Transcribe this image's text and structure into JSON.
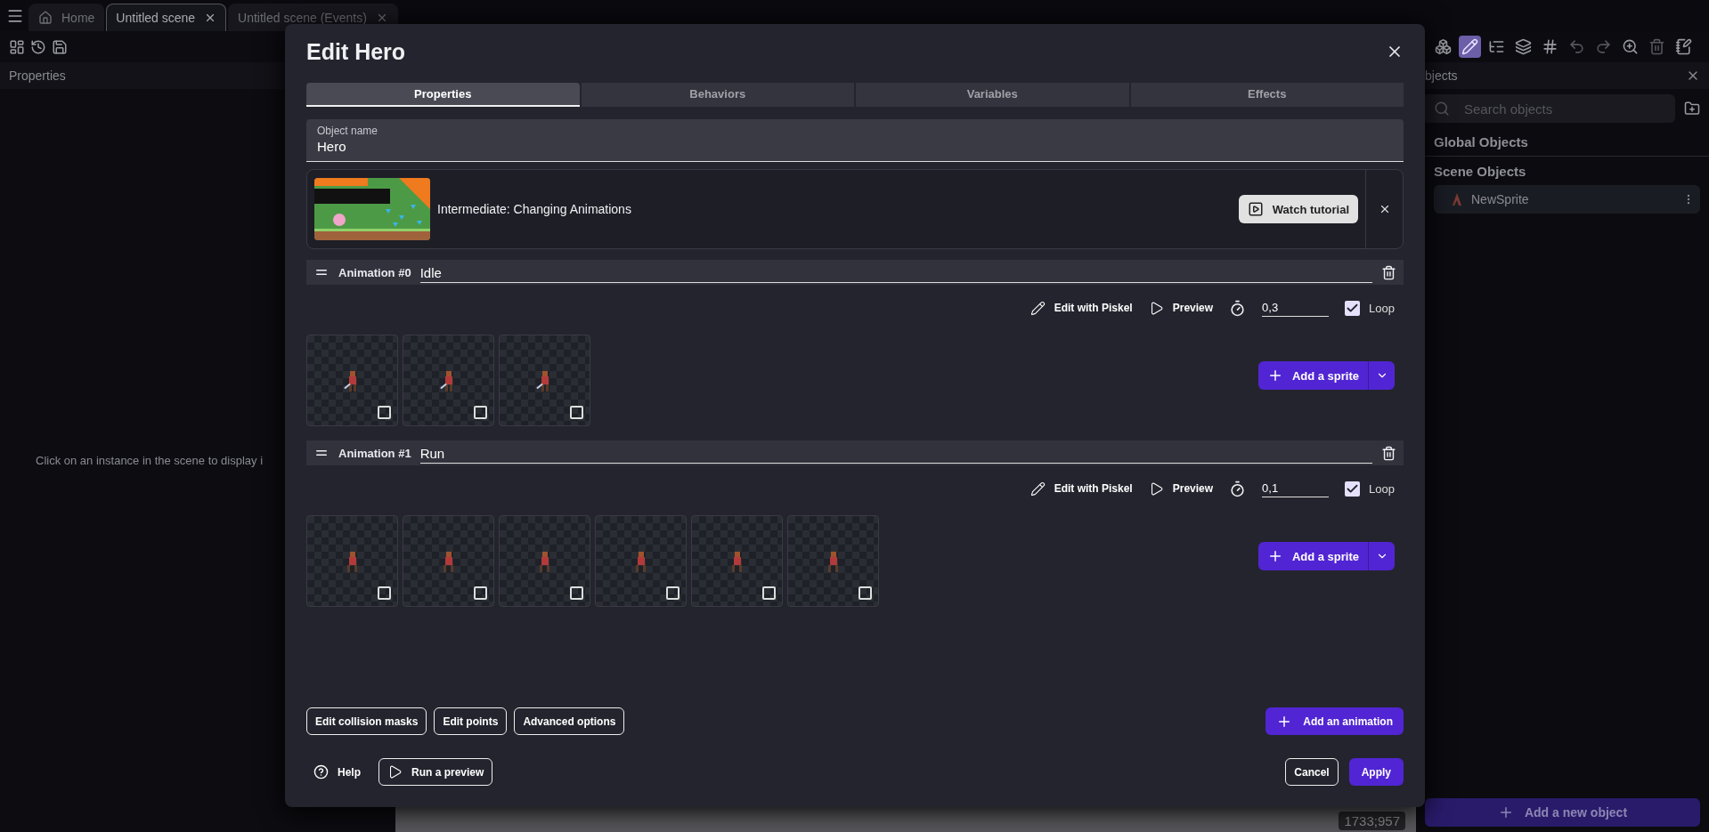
{
  "tabs": [
    {
      "label": "Home",
      "kind": "home",
      "selected": false
    },
    {
      "label": "Untitled scene",
      "kind": "scene",
      "selected": true
    },
    {
      "label": "Untitled scene (Events)",
      "kind": "scene",
      "selected": false
    }
  ],
  "left_panel": {
    "title": "Properties",
    "hint": "Click on an instance in the scene to display i"
  },
  "canvas": {
    "coordinates": "1733;957"
  },
  "tools": [
    {
      "kind": "cubes",
      "selected": false,
      "disabled": false
    },
    {
      "kind": "pencil",
      "selected": true,
      "disabled": false
    },
    {
      "kind": "list",
      "selected": false,
      "disabled": false
    },
    {
      "kind": "layers",
      "selected": false,
      "disabled": false
    },
    {
      "kind": "grid",
      "selected": false,
      "disabled": false
    },
    {
      "kind": "undo",
      "selected": false,
      "disabled": true
    },
    {
      "kind": "redo",
      "selected": false,
      "disabled": true
    },
    {
      "kind": "zoom",
      "selected": false,
      "disabled": false
    },
    {
      "kind": "trash",
      "selected": false,
      "disabled": true
    },
    {
      "kind": "notes",
      "selected": false,
      "disabled": false
    }
  ],
  "right_panel": {
    "title": "bjects",
    "search": {
      "placeholder": "Search objects"
    },
    "groups": [
      "Global Objects",
      "Scene Objects"
    ],
    "objects": [
      {
        "name": "NewSprite",
        "selected": true
      }
    ],
    "add_button": "Add a new object"
  },
  "dialog": {
    "title": "Edit Hero",
    "tabs": [
      {
        "label": "Properties",
        "selected": true
      },
      {
        "label": "Behaviors",
        "selected": false
      },
      {
        "label": "Variables",
        "selected": false
      },
      {
        "label": "Effects",
        "selected": false
      }
    ],
    "object_name": {
      "label": "Object name",
      "value": "Hero"
    },
    "tutorial": {
      "kind": "picture",
      "title": "Intermediate: Changing Animations",
      "button": "Watch tutorial"
    },
    "animations": [
      {
        "label": "Animation #0",
        "name": "Idle",
        "edit": "Edit with Piskel",
        "preview": "Preview",
        "duration": "0,3",
        "loop": true,
        "loop_label": "Loop",
        "add_sprite": "Add a sprite",
        "sprites": [
          {
            "checked": false
          },
          {
            "checked": false
          },
          {
            "checked": false
          }
        ]
      },
      {
        "label": "Animation #1",
        "name": "Run",
        "edit": "Edit with Piskel",
        "preview": "Preview",
        "duration": "0,1",
        "loop": true,
        "loop_label": "Loop",
        "add_sprite": "Add a sprite",
        "sprites": [
          {
            "checked": false
          },
          {
            "checked": false
          },
          {
            "checked": false
          },
          {
            "checked": false
          },
          {
            "checked": false
          },
          {
            "checked": false
          }
        ]
      }
    ],
    "actions": [
      "Edit collision masks",
      "Edit points",
      "Advanced options"
    ],
    "add_animation": "Add an animation",
    "help": "Help",
    "run_preview": "Run a preview",
    "cancel": "Cancel",
    "apply": "Apply"
  }
}
